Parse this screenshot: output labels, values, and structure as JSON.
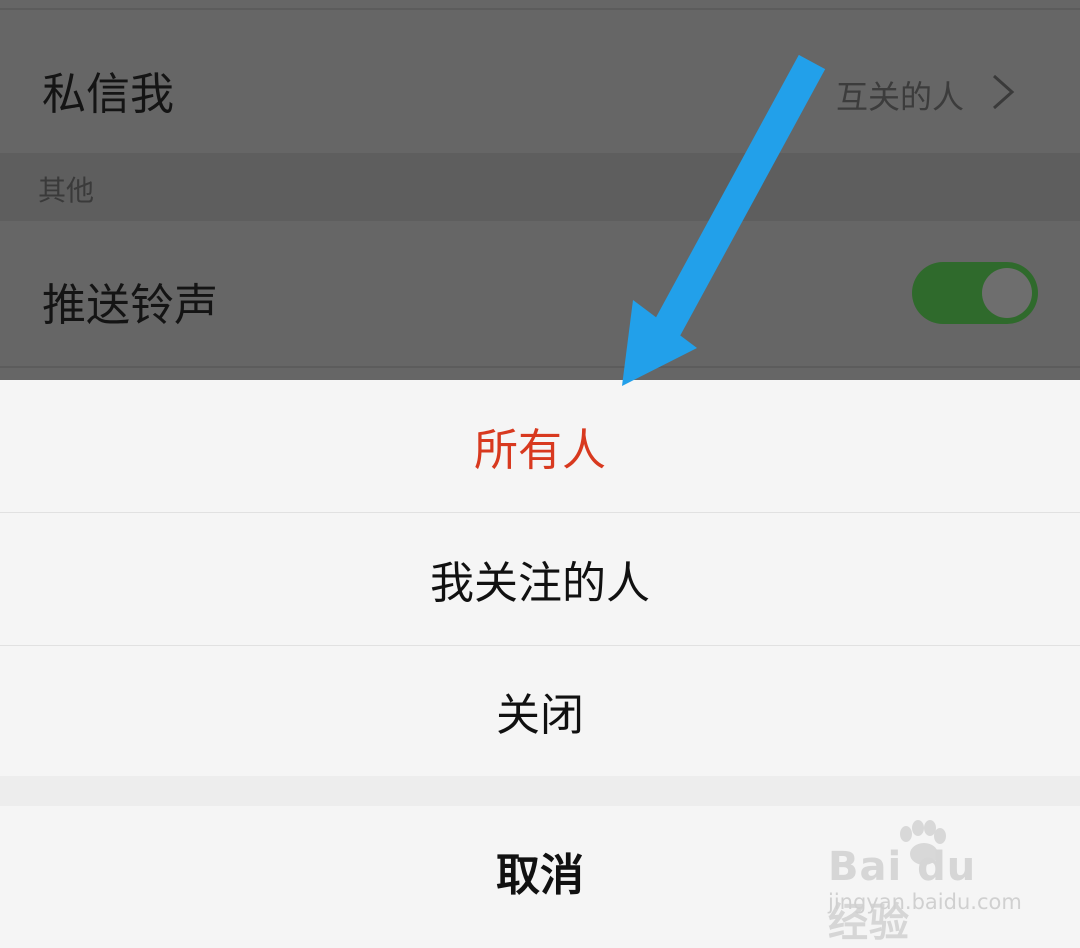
{
  "settings": {
    "dm_row": {
      "title": "私信我",
      "value": "互关的人"
    },
    "section_other": "其他",
    "push_ringtone": {
      "title": "推送铃声",
      "enabled": true
    }
  },
  "sheet": {
    "options": [
      {
        "label": "所有人",
        "selected": true
      },
      {
        "label": "我关注的人",
        "selected": false
      },
      {
        "label": "关闭",
        "selected": false
      }
    ],
    "cancel_label": "取消"
  },
  "watermark": {
    "brand": "Bai du 经验",
    "url": "jingyan.baidu.com"
  },
  "colors": {
    "selected": "#d8391f",
    "annotation_arrow": "#22a0ea",
    "toggle_on": "#2f6a2c"
  },
  "icons": {
    "chevron": "chevron-right-icon",
    "annotation": "arrow-annotation"
  }
}
